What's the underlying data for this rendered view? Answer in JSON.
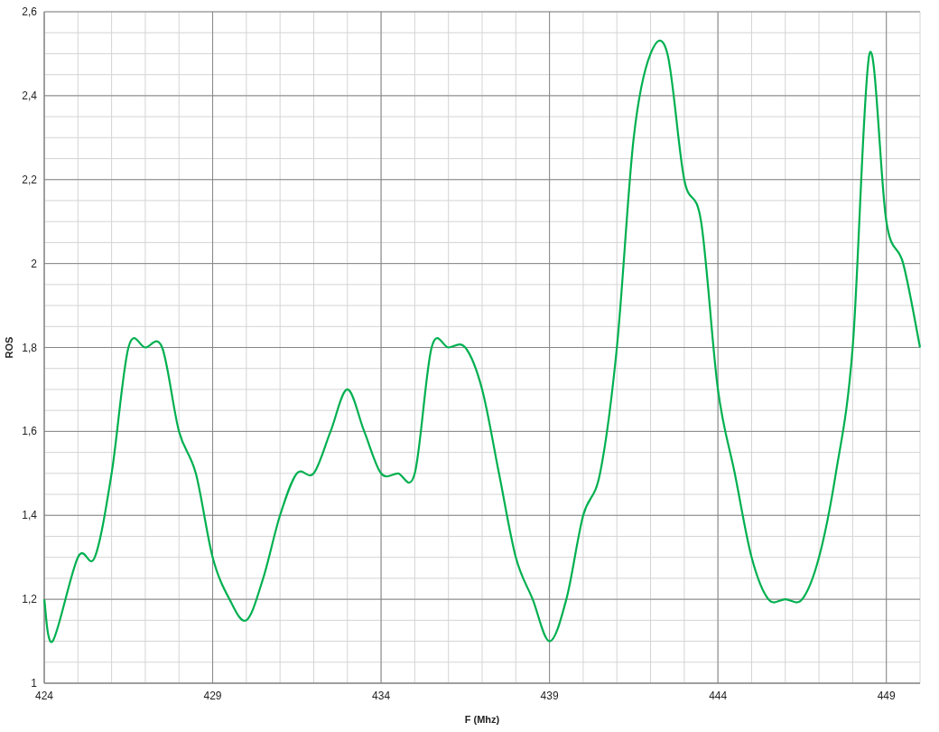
{
  "chart_data": {
    "type": "line",
    "xlabel": "F (Mhz)",
    "ylabel": "ROS",
    "x": [
      424,
      424.25,
      425,
      425.5,
      426,
      426.5,
      427,
      427.5,
      428,
      428.5,
      429,
      429.5,
      430,
      430.5,
      431,
      431.5,
      432,
      432.5,
      433,
      433.5,
      434,
      434.5,
      435,
      435.5,
      436,
      436.5,
      437,
      437.5,
      438,
      438.5,
      439,
      439.5,
      440,
      440.5,
      441,
      441.5,
      442,
      442.5,
      443,
      443.5,
      444,
      444.5,
      445,
      445.5,
      446,
      446.5,
      447,
      447.5,
      448,
      448.5,
      449,
      449.5,
      450
    ],
    "grid": true,
    "series": [
      {
        "color": "#00b050",
        "values": [
          1.2,
          1.1,
          1.3,
          1.3,
          1.5,
          1.8,
          1.8,
          1.8,
          1.6,
          1.5,
          1.3,
          1.2,
          1.15,
          1.25,
          1.4,
          1.5,
          1.5,
          1.6,
          1.7,
          1.6,
          1.5,
          1.5,
          1.5,
          1.8,
          1.8,
          1.8,
          1.7,
          1.5,
          1.3,
          1.2,
          1.1,
          1.2,
          1.4,
          1.5,
          1.8,
          2.3,
          2.5,
          2.5,
          2.2,
          2.1,
          1.7,
          1.5,
          1.3,
          1.2,
          1.2,
          1.2,
          1.3,
          1.5,
          1.8,
          2.5,
          2.1,
          2.0,
          1.8
        ]
      }
    ],
    "xlim": [
      424,
      450
    ],
    "ylim": [
      1,
      2.6
    ],
    "xticks": [
      424,
      429,
      434,
      439,
      444,
      449
    ],
    "yticks": [
      {
        "value": 1,
        "label": "1"
      },
      {
        "value": 1.2,
        "label": "1,2"
      },
      {
        "value": 1.4,
        "label": "1,4"
      },
      {
        "value": 1.6,
        "label": "1,6"
      },
      {
        "value": 1.8,
        "label": "1,8"
      },
      {
        "value": 2,
        "label": "2"
      },
      {
        "value": 2.2,
        "label": "2,2"
      },
      {
        "value": 2.4,
        "label": "2,4"
      },
      {
        "value": 2.6,
        "label": "2,6"
      }
    ]
  }
}
